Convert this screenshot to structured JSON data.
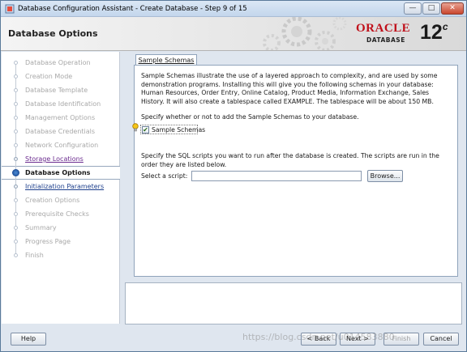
{
  "window": {
    "title": "Database Configuration Assistant - Create Database - Step 9 of 15",
    "minimize_label": "—",
    "maximize_label": "□",
    "close_label": "✕"
  },
  "header": {
    "page_title": "Database Options",
    "logo_oracle": "ORACLE",
    "logo_database": "DATABASE",
    "logo_version": "12",
    "logo_version_suffix": "c"
  },
  "sidebar": {
    "steps": [
      {
        "label": "Database Operation",
        "state": "done"
      },
      {
        "label": "Creation Mode",
        "state": "done"
      },
      {
        "label": "Database Template",
        "state": "done"
      },
      {
        "label": "Database Identification",
        "state": "done"
      },
      {
        "label": "Management Options",
        "state": "done"
      },
      {
        "label": "Database Credentials",
        "state": "done"
      },
      {
        "label": "Network Configuration",
        "state": "done"
      },
      {
        "label": "Storage Locations",
        "state": "visited-link"
      },
      {
        "label": "Database Options",
        "state": "current"
      },
      {
        "label": "Initialization Parameters",
        "state": "link"
      },
      {
        "label": "Creation Options",
        "state": "pending"
      },
      {
        "label": "Prerequisite Checks",
        "state": "pending"
      },
      {
        "label": "Summary",
        "state": "pending"
      },
      {
        "label": "Progress Page",
        "state": "pending"
      },
      {
        "label": "Finish",
        "state": "pending"
      }
    ]
  },
  "content": {
    "tab_label": "Sample Schemas",
    "description": "Sample Schemas illustrate the use of a layered approach to complexity, and are used by some demonstration programs. Installing this will give you the following schemas in your database: Human Resources, Order Entry, Online Catalog, Product Media, Information Exchange, Sales History. It will also create a tablespace called EXAMPLE. The tablespace will be about 150 MB.",
    "specify_text": "Specify whether or not to add the Sample Schemas to your database.",
    "checkbox_label": "Sample Schemas",
    "checkbox_checked": true,
    "scripts_text": "Specify the SQL scripts you want to run after the database is created. The scripts are run in the order they are listed below.",
    "select_script_label": "Select a script:",
    "select_script_value": "",
    "browse_label": "Browse..."
  },
  "footer": {
    "help_label": "Help",
    "back_label": "< Back",
    "next_label": "Next >",
    "finish_label": "Finish",
    "cancel_label": "Cancel"
  },
  "watermark": "https://blog.csdn.net/u014583880"
}
